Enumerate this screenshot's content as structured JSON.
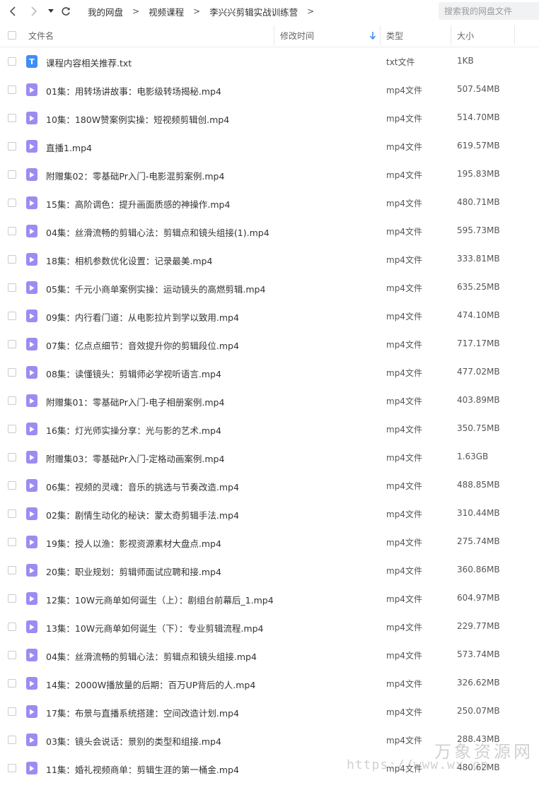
{
  "breadcrumb": [
    "我的网盘",
    "视频课程",
    "李兴兴剪辑实战训练营"
  ],
  "breadcrumb_separator": ">",
  "search": {
    "placeholder": "搜索我的网盘文件"
  },
  "columns": {
    "name": "文件名",
    "modified": "修改时间",
    "type": "类型",
    "size": "大小"
  },
  "colors": {
    "txt_icon": "#3e8ef7",
    "video_icon": "#9b8cf2",
    "sort_arrow": "#3e8ef7"
  },
  "files": [
    {
      "icon": "txt-file-icon",
      "name": "课程内容相关推荐.txt",
      "type": "txt文件",
      "size": "1KB"
    },
    {
      "icon": "video-file-icon",
      "name": "01集：用转场讲故事：电影级转场揭秘.mp4",
      "type": "mp4文件",
      "size": "507.54MB"
    },
    {
      "icon": "video-file-icon",
      "name": "10集：180W赞案例实操：短视频剪辑创.mp4",
      "type": "mp4文件",
      "size": "514.70MB"
    },
    {
      "icon": "video-file-icon",
      "name": "直播1.mp4",
      "type": "mp4文件",
      "size": "619.57MB"
    },
    {
      "icon": "video-file-icon",
      "name": "附赠集02：零基础Pr入门-电影混剪案例.mp4",
      "type": "mp4文件",
      "size": "195.83MB"
    },
    {
      "icon": "video-file-icon",
      "name": "15集：高阶调色：提升画面质感的神操作.mp4",
      "type": "mp4文件",
      "size": "480.71MB"
    },
    {
      "icon": "video-file-icon",
      "name": "04集：丝滑流畅的剪辑心法：剪辑点和镜头组接(1).mp4",
      "type": "mp4文件",
      "size": "595.73MB"
    },
    {
      "icon": "video-file-icon",
      "name": "18集：相机参数优化设置：记录最美.mp4",
      "type": "mp4文件",
      "size": "333.81MB"
    },
    {
      "icon": "video-file-icon",
      "name": "05集：千元小商单案例实操：运动镜头的高燃剪辑.mp4",
      "type": "mp4文件",
      "size": "635.25MB"
    },
    {
      "icon": "video-file-icon",
      "name": "09集：内行看门道：从电影拉片到学以致用.mp4",
      "type": "mp4文件",
      "size": "474.10MB"
    },
    {
      "icon": "video-file-icon",
      "name": "07集：亿点点细节：音效提升你的剪辑段位.mp4",
      "type": "mp4文件",
      "size": "717.17MB"
    },
    {
      "icon": "video-file-icon",
      "name": "08集：读懂镜头：剪辑师必学视听语言.mp4",
      "type": "mp4文件",
      "size": "477.02MB"
    },
    {
      "icon": "video-file-icon",
      "name": "附赠集01：零基础Pr入门-电子相册案例.mp4",
      "type": "mp4文件",
      "size": "403.89MB"
    },
    {
      "icon": "video-file-icon",
      "name": "16集：灯光师实操分享：光与影的艺术.mp4",
      "type": "mp4文件",
      "size": "350.75MB"
    },
    {
      "icon": "video-file-icon",
      "name": "附赠集03：零基础Pr入门-定格动画案例.mp4",
      "type": "mp4文件",
      "size": "1.63GB"
    },
    {
      "icon": "video-file-icon",
      "name": "06集：视频的灵魂：音乐的挑选与节奏改造.mp4",
      "type": "mp4文件",
      "size": "488.85MB"
    },
    {
      "icon": "video-file-icon",
      "name": "02集：剧情生动化的秘诀：蒙太奇剪辑手法.mp4",
      "type": "mp4文件",
      "size": "310.44MB"
    },
    {
      "icon": "video-file-icon",
      "name": "19集：授人以渔：影视资源素材大盘点.mp4",
      "type": "mp4文件",
      "size": "275.74MB"
    },
    {
      "icon": "video-file-icon",
      "name": "20集：职业规划：剪辑师面试应聘和接.mp4",
      "type": "mp4文件",
      "size": "360.86MB"
    },
    {
      "icon": "video-file-icon",
      "name": "12集：10W元商单如何诞生（上）：剧组台前幕后_1.mp4",
      "type": "mp4文件",
      "size": "604.97MB"
    },
    {
      "icon": "video-file-icon",
      "name": "13集：10W元商单如何诞生（下）：专业剪辑流程.mp4",
      "type": "mp4文件",
      "size": "229.77MB"
    },
    {
      "icon": "video-file-icon",
      "name": "04集：丝滑流畅的剪辑心法：剪辑点和镜头组接.mp4",
      "type": "mp4文件",
      "size": "573.74MB"
    },
    {
      "icon": "video-file-icon",
      "name": "14集：2000W播放量的后期：百万UP背后的人.mp4",
      "type": "mp4文件",
      "size": "326.62MB"
    },
    {
      "icon": "video-file-icon",
      "name": "17集：布景与直播系统搭建：空间改造计划.mp4",
      "type": "mp4文件",
      "size": "250.07MB"
    },
    {
      "icon": "video-file-icon",
      "name": "03集：镜头会说话：景别的类型和组接.mp4",
      "type": "mp4文件",
      "size": "288.43MB"
    },
    {
      "icon": "video-file-icon",
      "name": "11集：婚礼视频商单：剪辑生涯的第一桶金.mp4",
      "type": "mp4文件",
      "size": "480.62MB"
    }
  ],
  "watermark": {
    "text": "万象资源网",
    "url": "https://www.wx.cn"
  }
}
